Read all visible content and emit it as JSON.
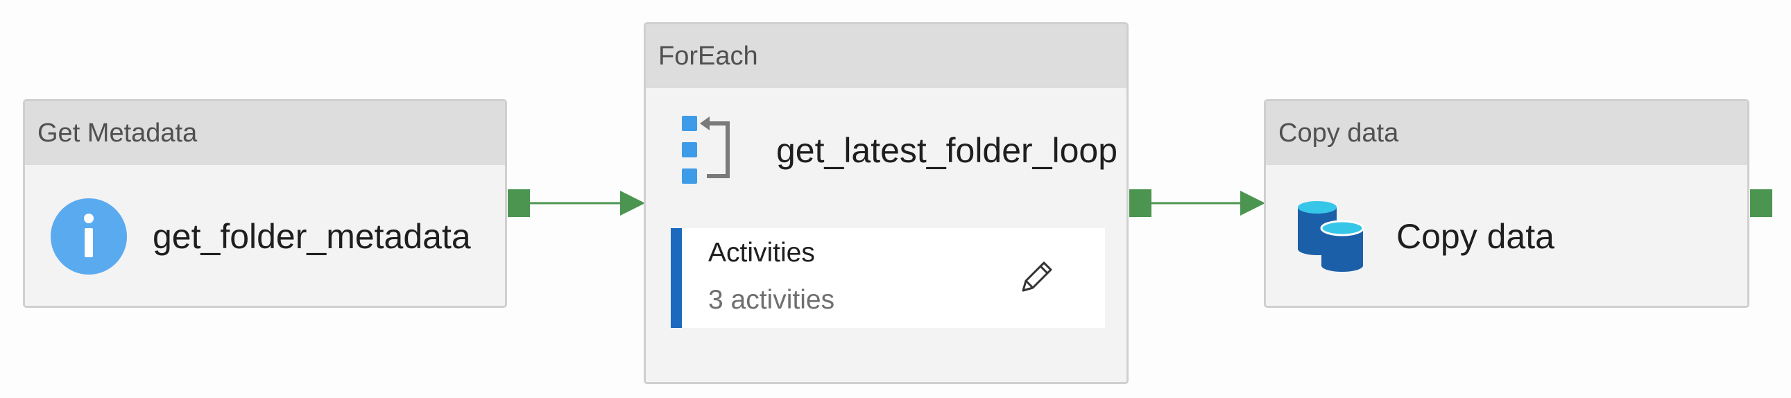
{
  "pipeline": {
    "activities": [
      {
        "type_label": "Get Metadata",
        "name": "get_folder_metadata",
        "icon": "info-icon"
      },
      {
        "type_label": "ForEach",
        "name": "get_latest_folder_loop",
        "icon": "foreach-loop-icon",
        "inner": {
          "title": "Activities",
          "count_text": "3 activities",
          "edit_icon": "pencil-icon"
        }
      },
      {
        "type_label": "Copy data",
        "name": "Copy data",
        "icon": "copy-data-icon"
      }
    ]
  },
  "colors": {
    "success_connector": "#4b9550",
    "header_bg": "#dddddd",
    "body_bg": "#f3f3f3",
    "inner_bar": "#1b6ac0",
    "info_icon": "#5aaaf0",
    "foreach_square": "#3e9be8",
    "copy_db_dark": "#1b5fa8",
    "copy_db_light": "#36c6e8"
  }
}
